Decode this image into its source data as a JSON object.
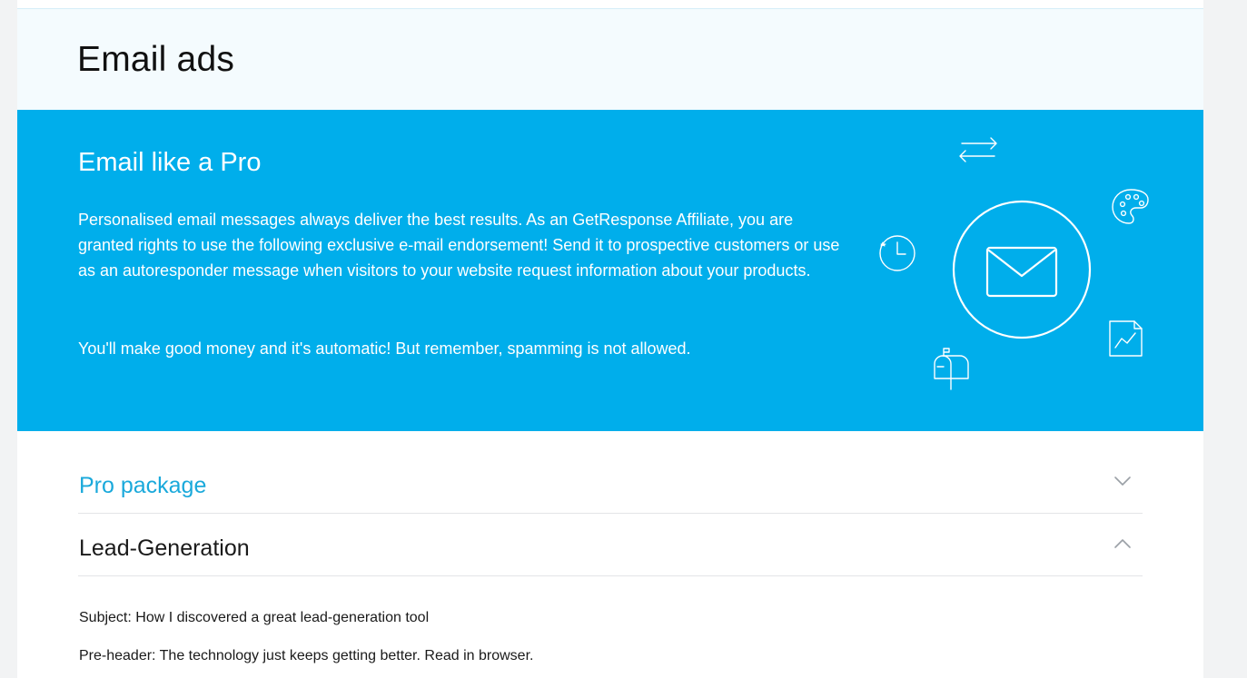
{
  "page": {
    "title": "Email ads"
  },
  "hero": {
    "heading": "Email like a Pro",
    "paragraph_1": "Personalised email messages always deliver the best results. As an GetResponse Affiliate, you are granted rights to use the following exclusive e-mail endorsement! Send it to prospective customers or use as an autoresponder message when visitors to your website request information about your products.",
    "paragraph_2": "You'll make good money and it's automatic! But remember, spamming is not allowed.",
    "background_color": "#00aeeb",
    "icons": [
      "envelope-icon",
      "repeat-arrows-icon",
      "palette-icon",
      "clock-icon",
      "chart-document-icon",
      "mailbox-icon"
    ]
  },
  "accordion": [
    {
      "label": "Pro package",
      "expanded": false,
      "accent_color": "#1aa9db",
      "toggle_icon": "chevron-down-icon"
    },
    {
      "label": "Lead-Generation",
      "expanded": true,
      "toggle_icon": "chevron-up-icon"
    }
  ],
  "email": {
    "subject": "Subject: How I discovered a great lead-generation tool",
    "preheader": "Pre-header: The technology just keeps getting better. Read in browser."
  }
}
